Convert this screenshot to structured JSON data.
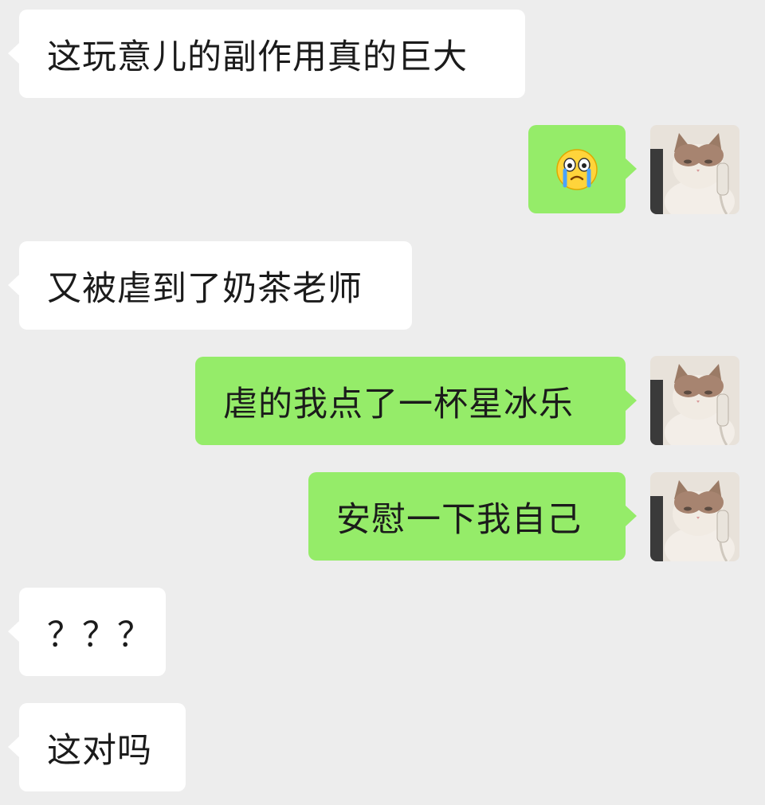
{
  "messages": [
    {
      "side": "in",
      "text": "这玩意儿的副作用真的巨大"
    },
    {
      "side": "out",
      "emoji": "crying-face",
      "avatar": "cat-on-phone-avatar"
    },
    {
      "side": "in",
      "text": "又被虐到了奶茶老师"
    },
    {
      "side": "out",
      "text": "虐的我点了一杯星冰乐",
      "avatar": "cat-on-phone-avatar"
    },
    {
      "side": "out",
      "text": "安慰一下我自己",
      "avatar": "cat-on-phone-avatar"
    },
    {
      "side": "in",
      "text": "？？？"
    },
    {
      "side": "in",
      "text": "这对吗"
    }
  ],
  "colors": {
    "background": "#ededed",
    "incoming_bubble": "#ffffff",
    "outgoing_bubble": "#95ec69"
  }
}
